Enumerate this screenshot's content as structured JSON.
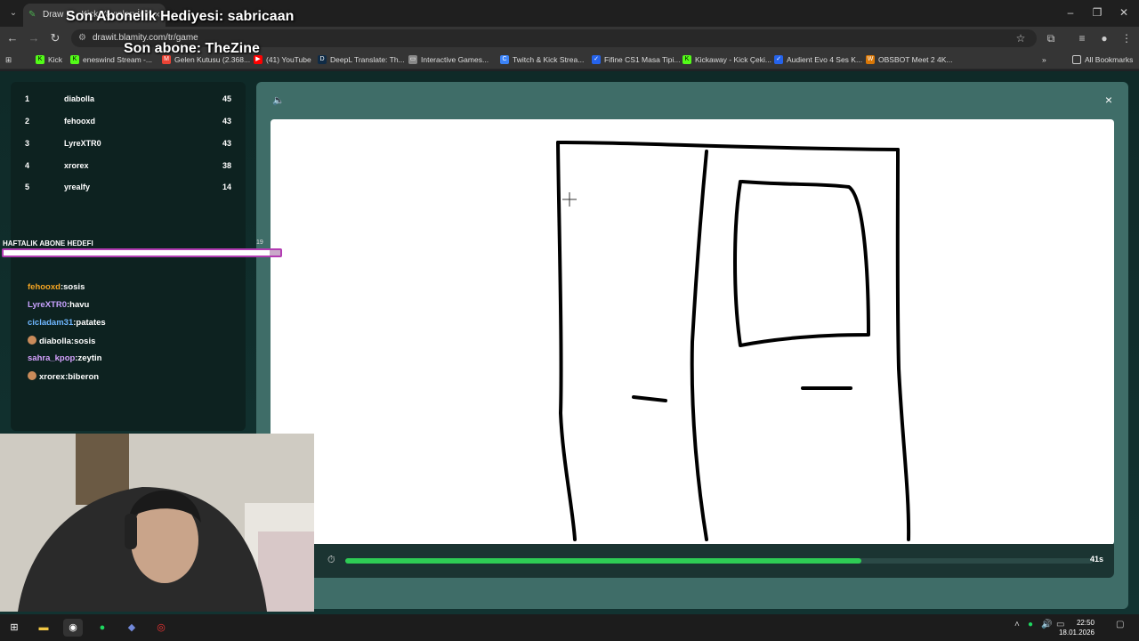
{
  "browser": {
    "tab_title": "Draw It! - Kick Yayınları İçin",
    "url": "drawit.blamity.com/tr/game",
    "bookmarks": [
      {
        "label": "Kick",
        "color": "#53fc18"
      },
      {
        "label": "eneswind Stream -...",
        "color": "#53fc18"
      },
      {
        "label": "Gelen Kutusu (2.368...",
        "color": "#ea4335"
      },
      {
        "label": "(41) YouTube",
        "color": "#ff0000"
      },
      {
        "label": "DeepL Translate: Th...",
        "color": "#0f2b46"
      },
      {
        "label": "Interactive Games...",
        "color": "#888888"
      },
      {
        "label": "Twitch & Kick Strea...",
        "color": "#3b82f6"
      },
      {
        "label": "Fifine CS1 Masa Tipi...",
        "color": "#2563eb"
      },
      {
        "label": "Kickaway - Kick Çeki...",
        "color": "#53fc18"
      },
      {
        "label": "Audient Evo 4 Ses K...",
        "color": "#2563eb"
      },
      {
        "label": "OBSBOT Meet 2 4K...",
        "color": "#d97706"
      }
    ],
    "all_bookmarks": "All Bookmarks"
  },
  "overlay": {
    "last_gift": "Son Abonelik Hediyesi: sabricaan",
    "last_sub": "Son abone: TheZine"
  },
  "leaderboard": [
    {
      "rank": "1",
      "name": "diabolla",
      "score": "45"
    },
    {
      "rank": "2",
      "name": "fehooxd",
      "score": "43"
    },
    {
      "rank": "3",
      "name": "LyreXTR0",
      "score": "43"
    },
    {
      "rank": "4",
      "name": "xrorex",
      "score": "38"
    },
    {
      "rank": "5",
      "name": "yrealfy",
      "score": "14"
    }
  ],
  "goal": {
    "label": "HAFTALIK ABONE HEDEFI",
    "count": "19",
    "progress": 0.96
  },
  "chat": [
    {
      "user": "fehooxd",
      "sep": ":",
      "msg": "sosis",
      "color": "#f5a623",
      "badge": false
    },
    {
      "user": "LyreXTR0",
      "sep": ":",
      "msg": "havu",
      "color": "#c8a2ff",
      "badge": false
    },
    {
      "user": "cicladam31",
      "sep": ":",
      "msg": "patates",
      "color": "#6fb7ff",
      "badge": false
    },
    {
      "user": "diabolla",
      "sep": ":",
      "msg": "sosis",
      "color": "#ffffff",
      "badge": true
    },
    {
      "user": "sahra_kpop",
      "sep": ":",
      "msg": "zeytin",
      "color": "#d6a2ff",
      "badge": false
    },
    {
      "user": "xrorex",
      "sep": ":",
      "msg": "biberon",
      "color": "#ffffff",
      "badge": true
    }
  ],
  "game": {
    "timer_text": "41s",
    "timer_progress": 0.69
  },
  "taskbar": {
    "time": "22:50",
    "date": "18.01.2026"
  }
}
